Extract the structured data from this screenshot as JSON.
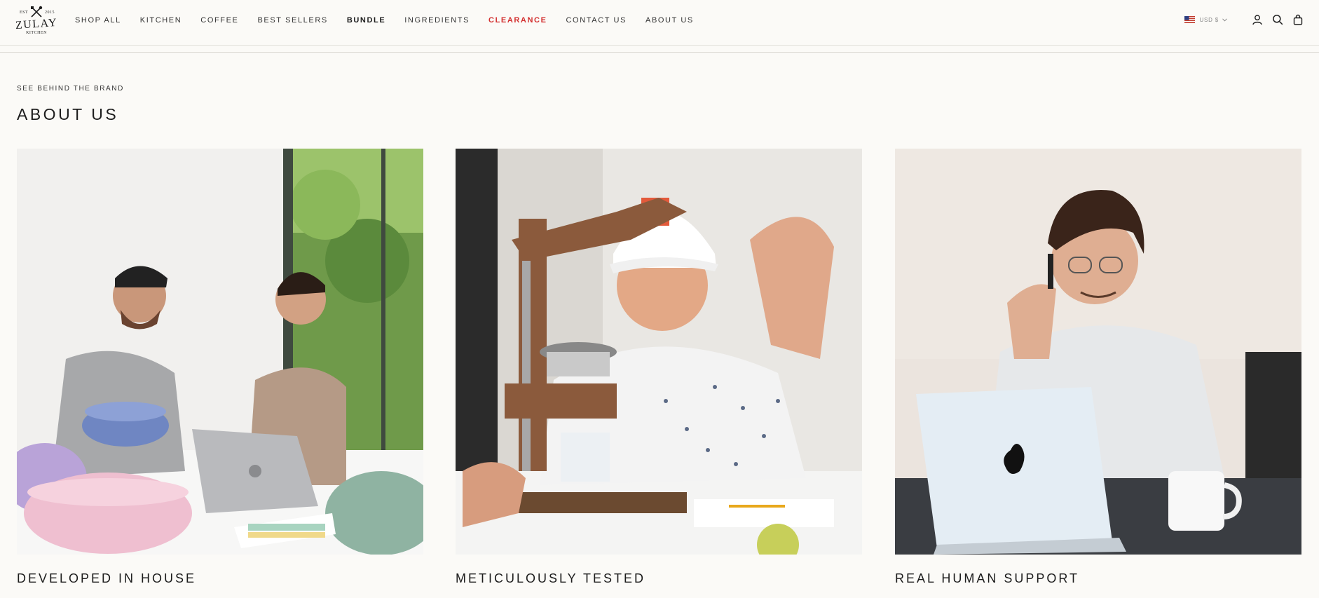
{
  "header": {
    "logo": {
      "est_left": "EST",
      "est_right": "2015",
      "brand": "ZULAY",
      "sub": "KITCHEN"
    },
    "nav": [
      {
        "label": "SHOP ALL",
        "style": "normal"
      },
      {
        "label": "KITCHEN",
        "style": "normal"
      },
      {
        "label": "COFFEE",
        "style": "normal"
      },
      {
        "label": "BEST SELLERS",
        "style": "normal"
      },
      {
        "label": "BUNDLE",
        "style": "bold"
      },
      {
        "label": "INGREDIENTS",
        "style": "normal"
      },
      {
        "label": "CLEARANCE",
        "style": "red"
      },
      {
        "label": "CONTACT US",
        "style": "normal"
      },
      {
        "label": "ABOUT US",
        "style": "normal"
      }
    ],
    "currency": "USD $",
    "icons": [
      "account-icon",
      "search-icon",
      "cart-icon"
    ],
    "accent_red": "#d32f2f"
  },
  "section": {
    "eyebrow": "SEE BEHIND THE BRAND",
    "title": "ABOUT US"
  },
  "cards": [
    {
      "caption": "DEVELOPED IN HOUSE"
    },
    {
      "caption": "METICULOUSLY TESTED"
    },
    {
      "caption": "REAL HUMAN SUPPORT"
    }
  ]
}
